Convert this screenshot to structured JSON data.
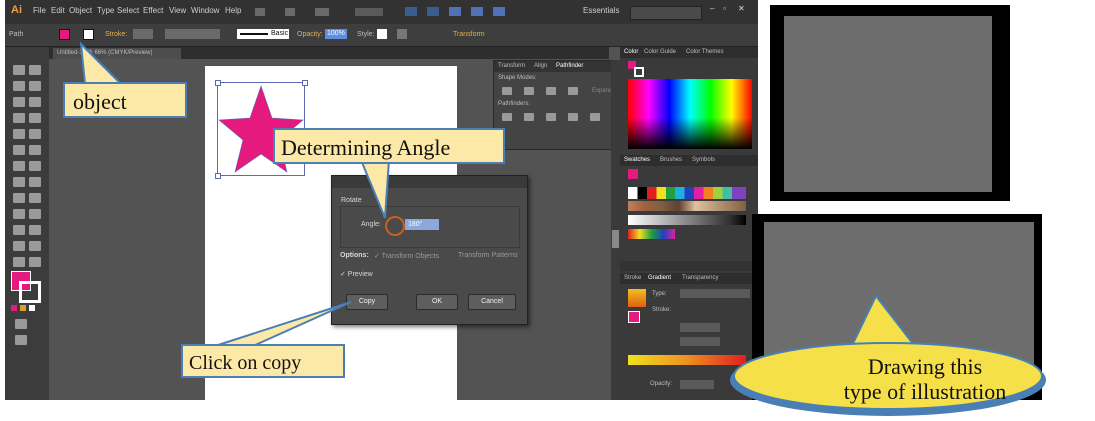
{
  "app": {
    "logo": "Ai",
    "menu": [
      "File",
      "Edit",
      "Object",
      "Type",
      "Select",
      "Effect",
      "View",
      "Window",
      "Help"
    ],
    "workspace": "Essentials",
    "control_bar": {
      "selection": "Path",
      "stroke_label": "Stroke:",
      "brush": "Basic",
      "opacity_label": "Opacity:",
      "opacity_value": "100%",
      "style_label": "Style:",
      "transform_label": "Transform"
    },
    "doc_tab": "Untitled-1* @ 66% (CMYK/Preview)",
    "panels": {
      "pathfinder_tabs": [
        "Transform",
        "Align",
        "Pathfinder"
      ],
      "shape_modes": "Shape Modes:",
      "pathfinders": "Pathfinders:",
      "expand": "Expand",
      "color_tabs": [
        "Color",
        "Color Guide",
        "Color Themes"
      ],
      "swatch_tabs": [
        "Swatches",
        "Brushes",
        "Symbols"
      ],
      "stroke_tabs": [
        "Stroke",
        "Gradient",
        "Transparency"
      ],
      "gradient_type": "Type:",
      "gradient_stroke": "Stroke:",
      "opacity": "Opacity:"
    },
    "colors": {
      "fill": "#e5197e",
      "star": "#e5197e"
    }
  },
  "dialog": {
    "section": "Rotate",
    "angle_label": "Angle:",
    "angle_value": "180°",
    "options_label": "Options:",
    "option1": "✓ Transform Objects",
    "option2": "Transform Patterns",
    "preview": "✓ Preview",
    "copy_button": "Copy",
    "ok_button": "OK",
    "cancel_button": "Cancel"
  },
  "callouts": {
    "object": "object",
    "angle": "Determining Angle",
    "copy": "Click on copy",
    "drawing_line1": "Drawing this",
    "drawing_line2": "type of illustration"
  }
}
